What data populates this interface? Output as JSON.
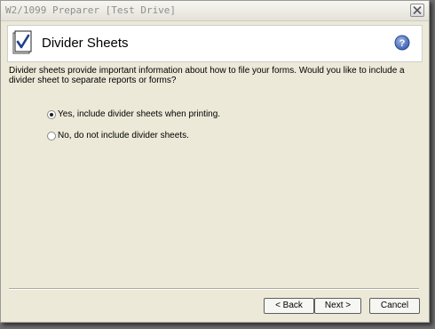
{
  "window": {
    "title": "W2/1099 Preparer [Test Drive]"
  },
  "header": {
    "title": "Divider Sheets",
    "icon": "checklist-icon",
    "help_icon": "help-icon"
  },
  "description": "Divider sheets provide important information about how to file your forms. Would you like to include a divider sheet to separate reports or forms?",
  "options": [
    {
      "label": "Yes, include divider sheets when printing.",
      "selected": true
    },
    {
      "label": "No, do not include divider sheets.",
      "selected": false
    }
  ],
  "buttons": {
    "back": "< Back",
    "next": "Next >",
    "cancel": "Cancel"
  },
  "colors": {
    "dialog_bg": "#ece9d8",
    "header_bg": "#ffffff",
    "checkmark_blue": "#1f3f8f",
    "help_blue": "#3f63b0"
  }
}
